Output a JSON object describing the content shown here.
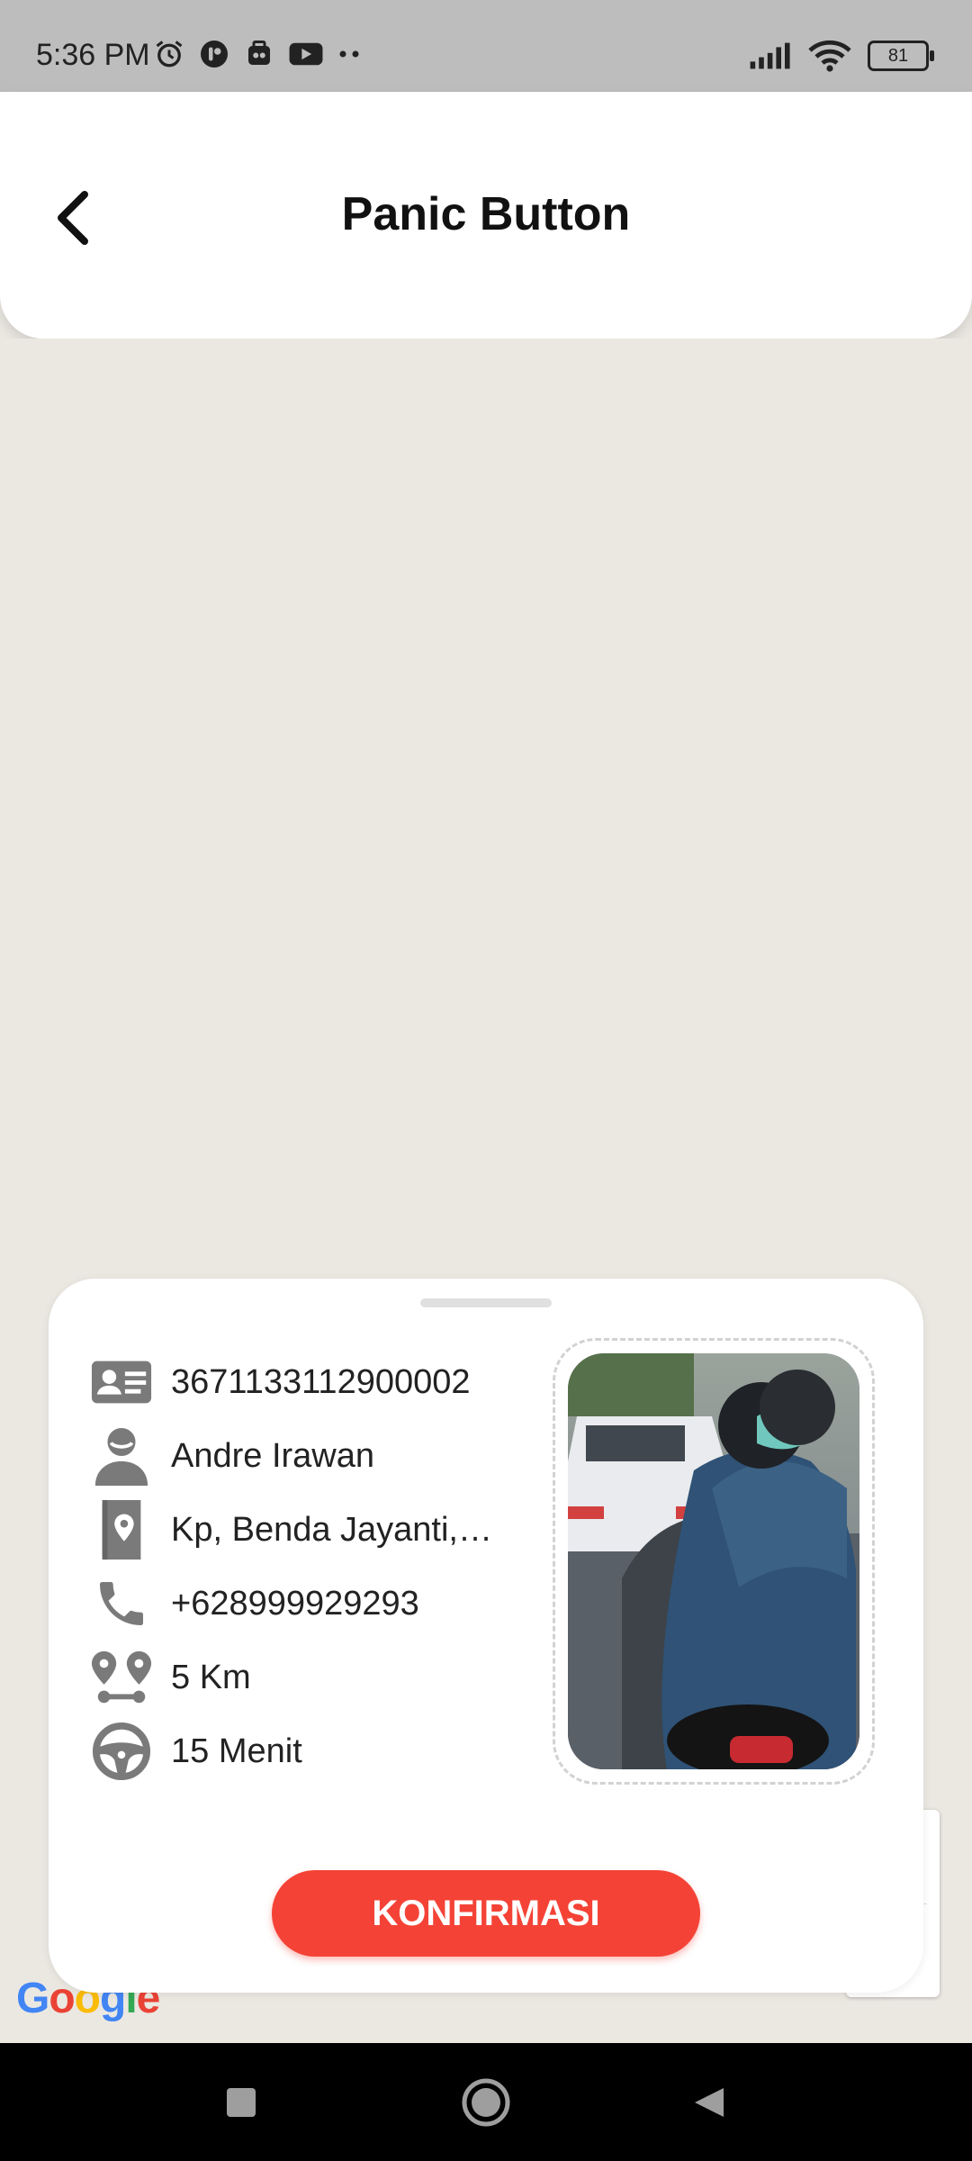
{
  "status_bar": {
    "time": "5:36 PM",
    "battery_level": "81",
    "icons": [
      "alarm-icon",
      "app-icon",
      "app-icon",
      "youtube-icon",
      "more-icon",
      "signal-icon",
      "wifi-icon",
      "battery-icon"
    ]
  },
  "header": {
    "title": "Panic Button",
    "back_icon": "chevron-left-icon"
  },
  "card": {
    "rows": [
      {
        "icon": "id-card-icon",
        "text": "3671133112900002"
      },
      {
        "icon": "user-icon",
        "text": "Andre Irawan"
      },
      {
        "icon": "address-book-icon",
        "text": "Kp, Benda Jayanti, ..."
      },
      {
        "icon": "phone-icon",
        "text": "+628999929293"
      },
      {
        "icon": "route-icon",
        "text": "5 Km"
      },
      {
        "icon": "steering-wheel-icon",
        "text": "15 Menit"
      }
    ],
    "photo_icon": "reported-photo",
    "confirm_label": "KONFIRMASI"
  },
  "map": {
    "logo_text": "Google"
  },
  "colors": {
    "accent": "#f44336",
    "icon_gray": "#7a7a7a",
    "map_bg": "#ebe8e2"
  }
}
